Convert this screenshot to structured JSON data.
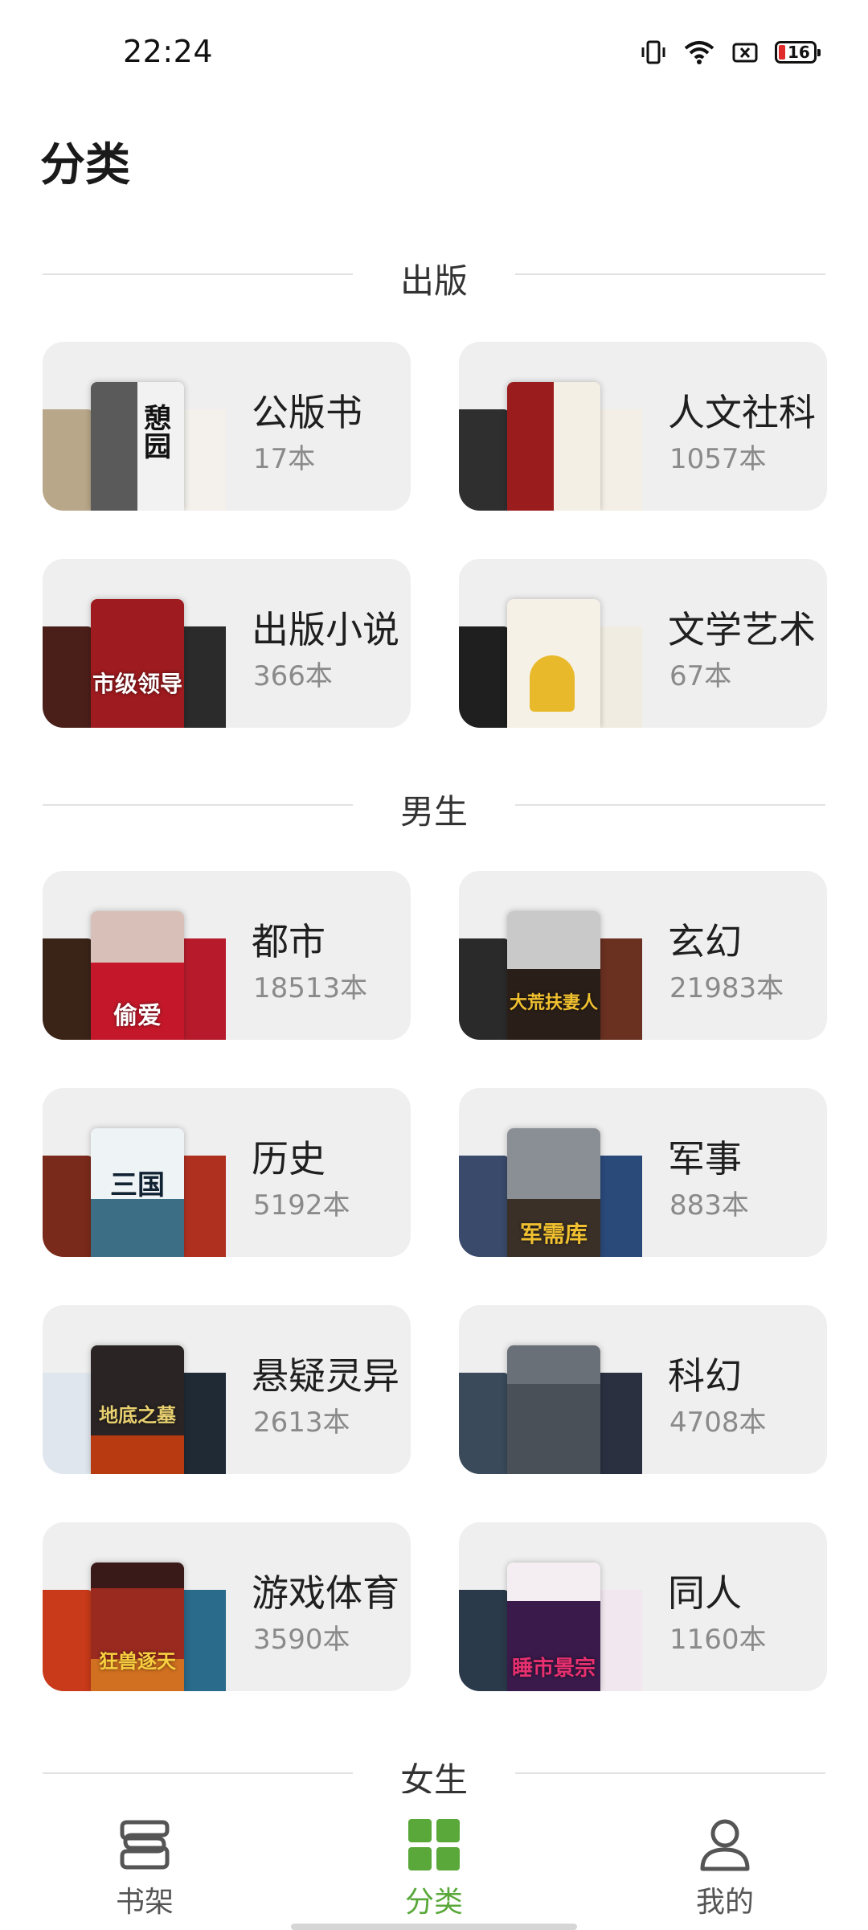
{
  "status_bar": {
    "time": "22:24",
    "battery": "16"
  },
  "page": {
    "title": "分类"
  },
  "sections": [
    {
      "label": "出版"
    },
    {
      "label": "男生"
    },
    {
      "label": "女生"
    }
  ],
  "cards": [
    {
      "name": "公版书",
      "count": "17本",
      "covers": {
        "left": "#b8a789",
        "front": "#4a4a4a",
        "right": "#f4f1ec"
      },
      "front_text": "憩园"
    },
    {
      "name": "人文社科",
      "count": "1057本",
      "covers": {
        "left": "#2f2f2f",
        "front": "#9b1c1c",
        "right": "#f3efe6"
      },
      "front_text": ""
    },
    {
      "name": "出版小说",
      "count": "366本",
      "covers": {
        "left": "#4a1f1a",
        "front": "#9e1b1f",
        "right": "#2b2b2b"
      },
      "front_text": "市级领导"
    },
    {
      "name": "文学艺术",
      "count": "67本",
      "covers": {
        "left": "#1f1f1f",
        "front": "#f6f1e6",
        "right": "#f0ece2"
      },
      "front_text": ""
    },
    {
      "name": "都市",
      "count": "18513本",
      "covers": {
        "left": "#3a2418",
        "front": "#c4182a",
        "right": "#b71b2b"
      },
      "front_text": "偷爱"
    },
    {
      "name": "玄幻",
      "count": "21983本",
      "covers": {
        "left": "#2a2a2a",
        "front": "#5a4a3a",
        "right": "#6a3020"
      },
      "front_text": "大荒扶妻人"
    },
    {
      "name": "历史",
      "count": "5192本",
      "covers": {
        "left": "#7a2a1a",
        "front": "#3c6f86",
        "right": "#b03020"
      },
      "front_text": "三国"
    },
    {
      "name": "军事",
      "count": "883本",
      "covers": {
        "left": "#3a4a6a",
        "front": "#5b6470",
        "right": "#2a4a7a"
      },
      "front_text": "军需库"
    },
    {
      "name": "悬疑灵异",
      "count": "2613本",
      "covers": {
        "left": "#dfe6ee",
        "front": "#2a2424",
        "right": "#1f2a35"
      },
      "front_text": "地底之墓"
    },
    {
      "name": "科幻",
      "count": "4708本",
      "covers": {
        "left": "#3a4a5a",
        "front": "#4a5058",
        "right": "#2a3040"
      },
      "front_text": ""
    },
    {
      "name": "游戏体育",
      "count": "3590本",
      "covers": {
        "left": "#c83a1a",
        "front": "#7a2a20",
        "right": "#2a6a8a"
      },
      "front_text": "狂兽逐天"
    },
    {
      "name": "同人",
      "count": "1160本",
      "covers": {
        "left": "#2a3a4a",
        "front": "#3a1a4a",
        "right": "#f0e8ee"
      },
      "front_text": "睡市景宗"
    }
  ],
  "nav": {
    "items": [
      {
        "label": "书架",
        "icon": "bookshelf-icon"
      },
      {
        "label": "分类",
        "icon": "category-grid-icon",
        "active": true
      },
      {
        "label": "我的",
        "icon": "profile-icon"
      }
    ],
    "accent": "#5aa83a",
    "inactive": "#555555"
  }
}
